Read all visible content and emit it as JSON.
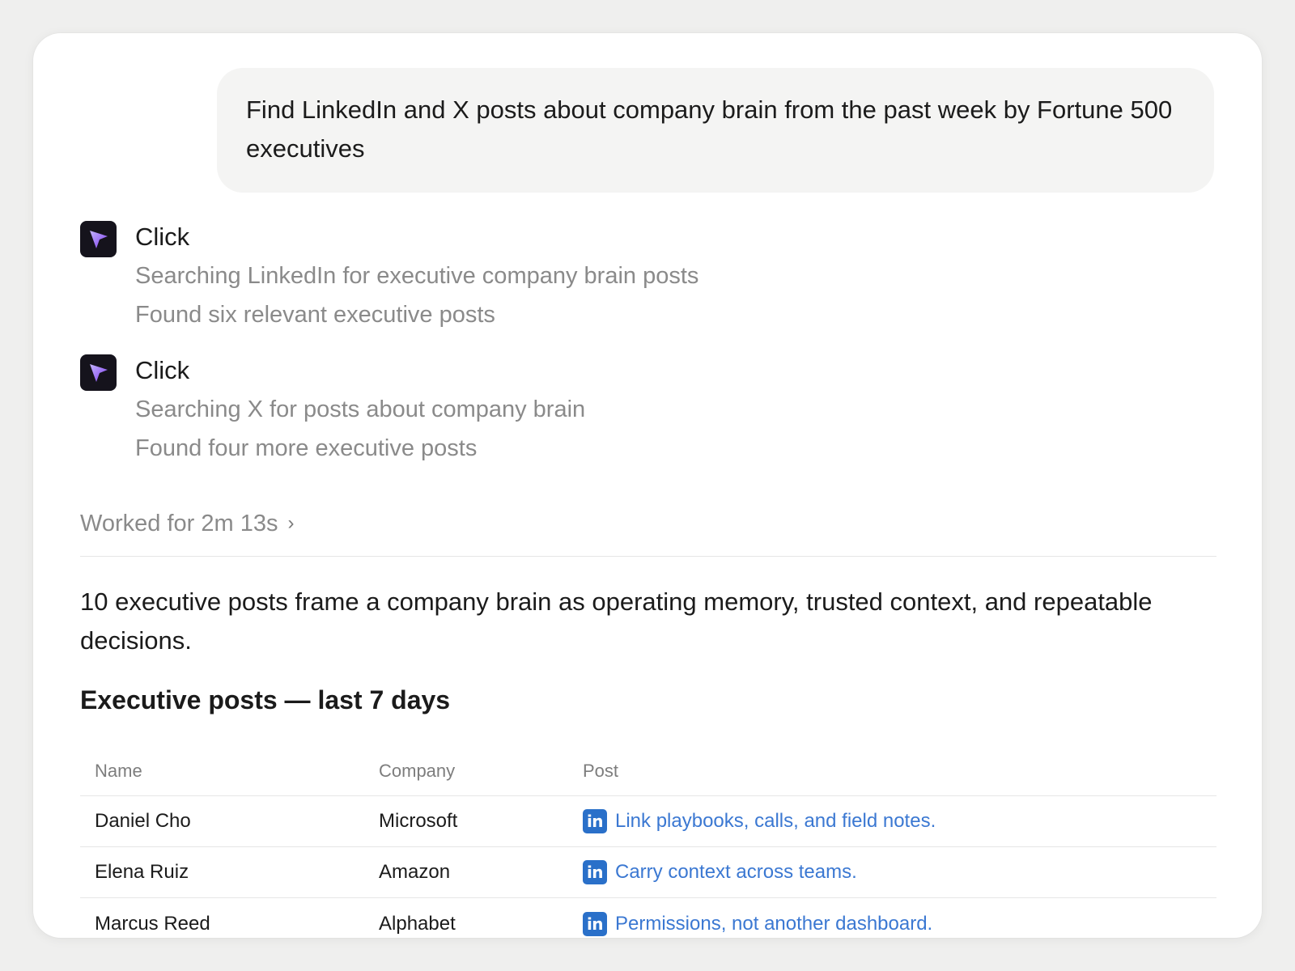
{
  "user_message": "Find LinkedIn and X posts about company brain from the past week by Fortune 500 executives",
  "steps": [
    {
      "title": "Click",
      "icon": "cursor-arrow-icon",
      "lines": [
        "Searching LinkedIn for executive company brain posts",
        "Found six relevant executive posts"
      ]
    },
    {
      "title": "Click",
      "icon": "cursor-arrow-icon",
      "lines": [
        "Searching X for posts about company brain",
        "Found four more executive posts"
      ]
    }
  ],
  "worked_for": "Worked for 2m 13s",
  "worked_chevron": "›",
  "summary": "10 executive posts frame a company brain as operating memory, trusted context, and repeatable decisions.",
  "section_heading": "Executive posts — last 7 days",
  "table": {
    "headers": {
      "name": "Name",
      "company": "Company",
      "post": "Post"
    },
    "rows": [
      {
        "name": "Daniel Cho",
        "company": "Microsoft",
        "post_icon": "in",
        "post": "Link playbooks, calls, and field notes."
      },
      {
        "name": "Elena Ruiz",
        "company": "Amazon",
        "post_icon": "in",
        "post": "Carry context across teams."
      },
      {
        "name": "Marcus Reed",
        "company": "Alphabet",
        "post_icon": "in",
        "post": "Permissions, not another dashboard."
      }
    ]
  },
  "colors": {
    "icon_bg": "#15131c",
    "icon_arrow": "#8b5cf6",
    "link": "#3b78d2",
    "linkedin": "#2a70c9"
  }
}
